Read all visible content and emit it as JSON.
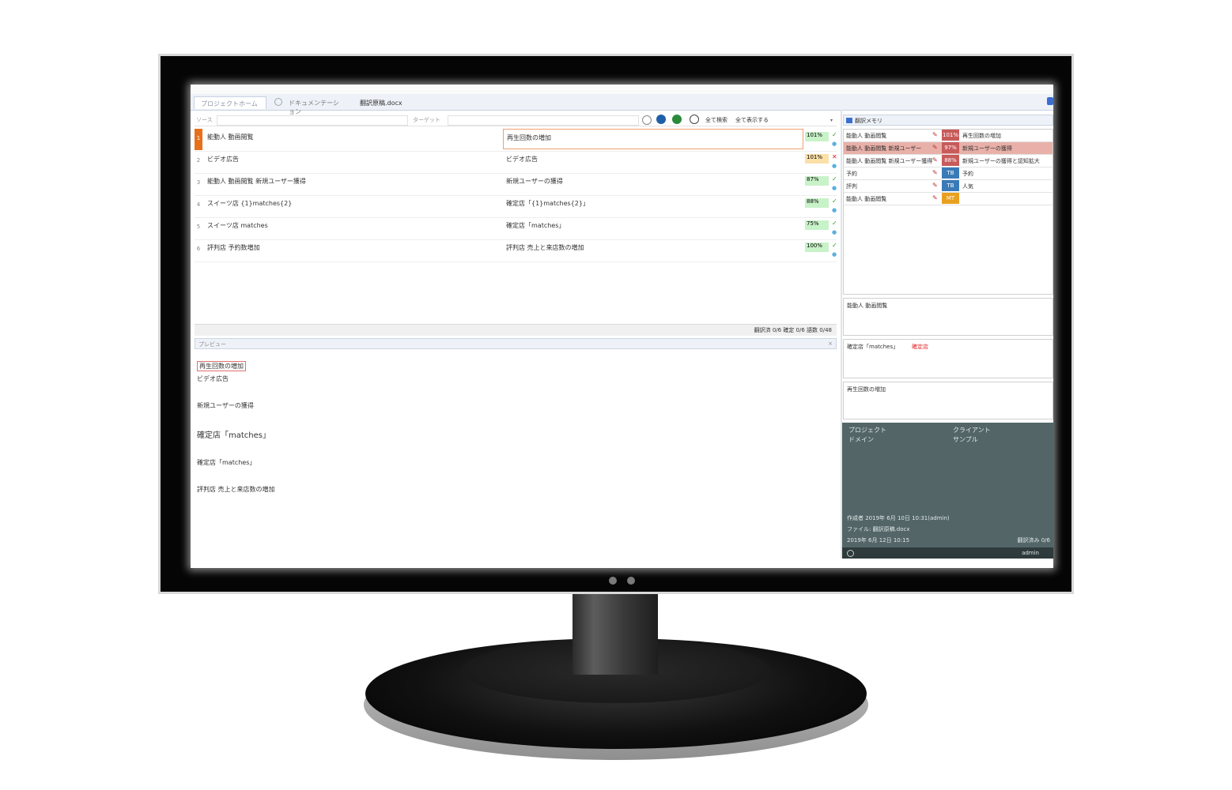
{
  "tabs": [
    {
      "label": "プロジェクトホーム",
      "active": true
    },
    {
      "label": "ドキュメンテーション",
      "active": false
    },
    {
      "label": "翻訳原稿.docx",
      "active": false
    }
  ],
  "filter": {
    "source_label": "ソース",
    "target_label": "ターゲット",
    "search_label": "全て検索",
    "filter_label": "全て表示する"
  },
  "segments": [
    {
      "num": "1",
      "source": "能動人 動画閲覧",
      "target": "再生回数の増加",
      "pct": "101%",
      "pct_color": "#c8f2c8",
      "status": "ok"
    },
    {
      "num": "2",
      "source": "ビデオ広告",
      "target": "ビデオ広告",
      "pct": "101%",
      "pct_color": "#fbe0a8",
      "status": "error"
    },
    {
      "num": "3",
      "source": "能動人 動画閲覧 新規ユーザー獲得",
      "target": "新規ユーザーの獲得",
      "pct": "87%",
      "pct_color": "#c8f2c8",
      "status": "ok"
    },
    {
      "num": "4",
      "source": "スイーツ店 {1}matches{2}",
      "target": "確定店「{1}matches{2}」",
      "pct": "88%",
      "pct_color": "#c8f2c8",
      "status": "ok"
    },
    {
      "num": "5",
      "source": "スイーツ店 matches",
      "target": "確定店「matches」",
      "pct": "75%",
      "pct_color": "#c8f2c8",
      "status": "ok"
    },
    {
      "num": "6",
      "source": "評判店 予約数増加",
      "target": "評判店 売上と来店数の増加",
      "pct": "100%",
      "pct_color": "#c8f2c8",
      "status": "ok"
    }
  ],
  "grid_status": "翻訳済 0/6 確定 0/6 語数 0/48",
  "preview": {
    "header": "プレビュー",
    "lines": [
      "再生回数の増加",
      "ビデオ広告",
      "新規ユーザーの獲得",
      "確定店「matches」",
      "確定店「matches」",
      "評判店 売上と来店数の増加"
    ]
  },
  "tm_panel": {
    "title": "翻訳メモリ",
    "rows": [
      {
        "source": "能動人 動画閲覧",
        "badge": "101%",
        "badge_color": "#c85a5a",
        "target": "再生回数の増加",
        "highlight": false
      },
      {
        "source": "能動人 動画閲覧 新規ユーザー",
        "badge": "97%",
        "badge_color": "#c85a5a",
        "target": "新規ユーザーの獲得",
        "highlight": true
      },
      {
        "source": "能動人 動画閲覧 新規ユーザー獲得",
        "badge": "88%",
        "badge_color": "#c85a5a",
        "target": "新規ユーザーの獲得と認知拡大",
        "highlight": false
      },
      {
        "source": "予約",
        "badge": "TB",
        "badge_color": "#3a7ab8",
        "target": "予約",
        "highlight": false
      },
      {
        "source": "評判",
        "badge": "TB",
        "badge_color": "#3a7ab8",
        "target": "人気",
        "highlight": false
      },
      {
        "source": "能動人 動画閲覧",
        "badge": "MT",
        "badge_color": "#e8a020",
        "target": "",
        "highlight": false
      }
    ]
  },
  "concordance": {
    "line1": "能動人 動画閲覧"
  },
  "compare": {
    "prefix": "確定店「matches」",
    "changed": "確定店"
  },
  "term_box": {
    "line": "再生回数の増加"
  },
  "info": {
    "project_label": "プロジェクト",
    "client_label": "クライアント",
    "project_value": "ドメイン",
    "client_value": "サンプル",
    "modified": "作成者 2019年 6月 10日 10:31(admin)",
    "file": "ファイル: 翻訳原稿.docx",
    "date": "2019年 6月 12日 10:15",
    "status_right": "翻訳済み 0/6",
    "footer_right": "admin"
  }
}
